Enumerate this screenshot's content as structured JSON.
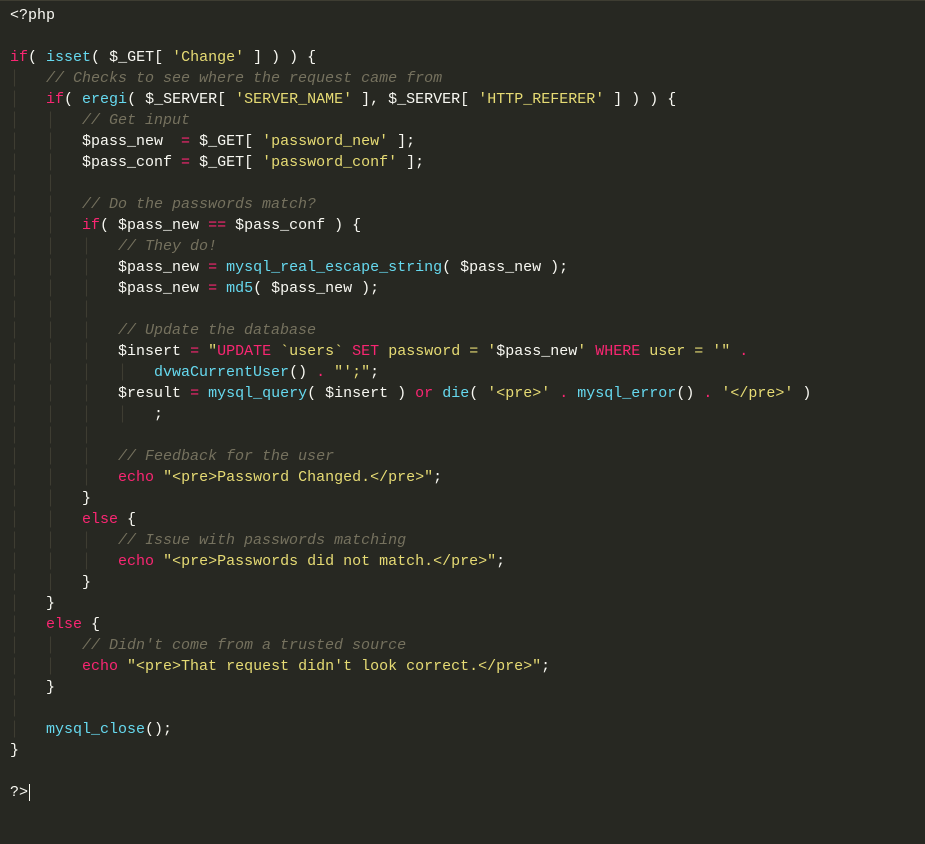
{
  "editor": {
    "language": "php",
    "theme": "monokai",
    "colors": {
      "background": "#272822",
      "foreground": "#f8f8f2",
      "keyword": "#f92672",
      "function": "#66d9ef",
      "string": "#e6db74",
      "comment": "#75715e",
      "indent_guide": "#3e3d32"
    },
    "code_lines": [
      "<?php",
      "",
      "if( isset( $_GET[ 'Change' ] ) ) {",
      "    // Checks to see where the request came from",
      "    if( eregi( $_SERVER[ 'SERVER_NAME' ], $_SERVER[ 'HTTP_REFERER' ] ) ) {",
      "        // Get input",
      "        $pass_new  = $_GET[ 'password_new' ];",
      "        $pass_conf = $_GET[ 'password_conf' ];",
      "",
      "        // Do the passwords match?",
      "        if( $pass_new == $pass_conf ) {",
      "            // They do!",
      "            $pass_new = mysql_real_escape_string( $pass_new );",
      "            $pass_new = md5( $pass_new );",
      "",
      "            // Update the database",
      "            $insert = \"UPDATE `users` SET password = '$pass_new' WHERE user = '\" . dvwaCurrentUser() . \"';\";",
      "            $result = mysql_query( $insert ) or die( '<pre>' . mysql_error() . '</pre>' );",
      "",
      "            // Feedback for the user",
      "            echo \"<pre>Password Changed.</pre>\";",
      "        }",
      "        else {",
      "            // Issue with passwords matching",
      "            echo \"<pre>Passwords did not match.</pre>\";",
      "        }",
      "    }",
      "    else {",
      "        // Didn't come from a trusted source",
      "        echo \"<pre>That request didn't look correct.</pre>\";",
      "    }",
      "",
      "    mysql_close();",
      "}",
      "",
      "?>"
    ],
    "tokens": {
      "php_open": "<?php",
      "php_close": "?>",
      "kw_if": "if",
      "kw_else": "else",
      "kw_echo": "echo",
      "kw_or": "or",
      "fn_isset": "isset",
      "fn_eregi": "eregi",
      "fn_mres": "mysql_real_escape_string",
      "fn_md5": "md5",
      "fn_mq": "mysql_query",
      "fn_die": "die",
      "fn_merr": "mysql_error",
      "fn_dvwa": "dvwaCurrentUser",
      "fn_mclose": "mysql_close",
      "var_get": "$_GET",
      "var_server": "$_SERVER",
      "var_pnew": "$pass_new",
      "var_pconf": "$pass_conf",
      "var_insert": "$insert",
      "var_result": "$result",
      "str_change": "'Change'",
      "str_sname": "'SERVER_NAME'",
      "str_href": "'HTTP_REFERER'",
      "str_pnew": "'password_new'",
      "str_pconf": "'password_conf'",
      "str_sql1a": "\"UPDATE `users` SET password = '",
      "sql_update": "UPDATE",
      "sql_set": "SET",
      "sql_where": "WHERE",
      "str_users": "`users`",
      "str_sql1b": "$pass_new",
      "str_sql1c": "' ",
      "str_sql1d": " user = '\"",
      "str_sql2": "\"';\"",
      "str_pre_o": "'<pre>'",
      "str_pre_c": "'</pre>'",
      "str_ok": "\"<pre>Password Changed.</pre>\"",
      "str_nomatch": "\"<pre>Passwords did not match.</pre>\"",
      "str_badreq": "\"<pre>That request didn't look correct.</pre>\"",
      "cmt_1": "// Checks to see where the request came from",
      "cmt_2": "// Get input",
      "cmt_3": "// Do the passwords match?",
      "cmt_4": "// They do!",
      "cmt_5": "// Update the database",
      "cmt_6": "// Feedback for the user",
      "cmt_7": "// Issue with passwords matching",
      "cmt_8": "// Didn't come from a trusted source"
    }
  }
}
